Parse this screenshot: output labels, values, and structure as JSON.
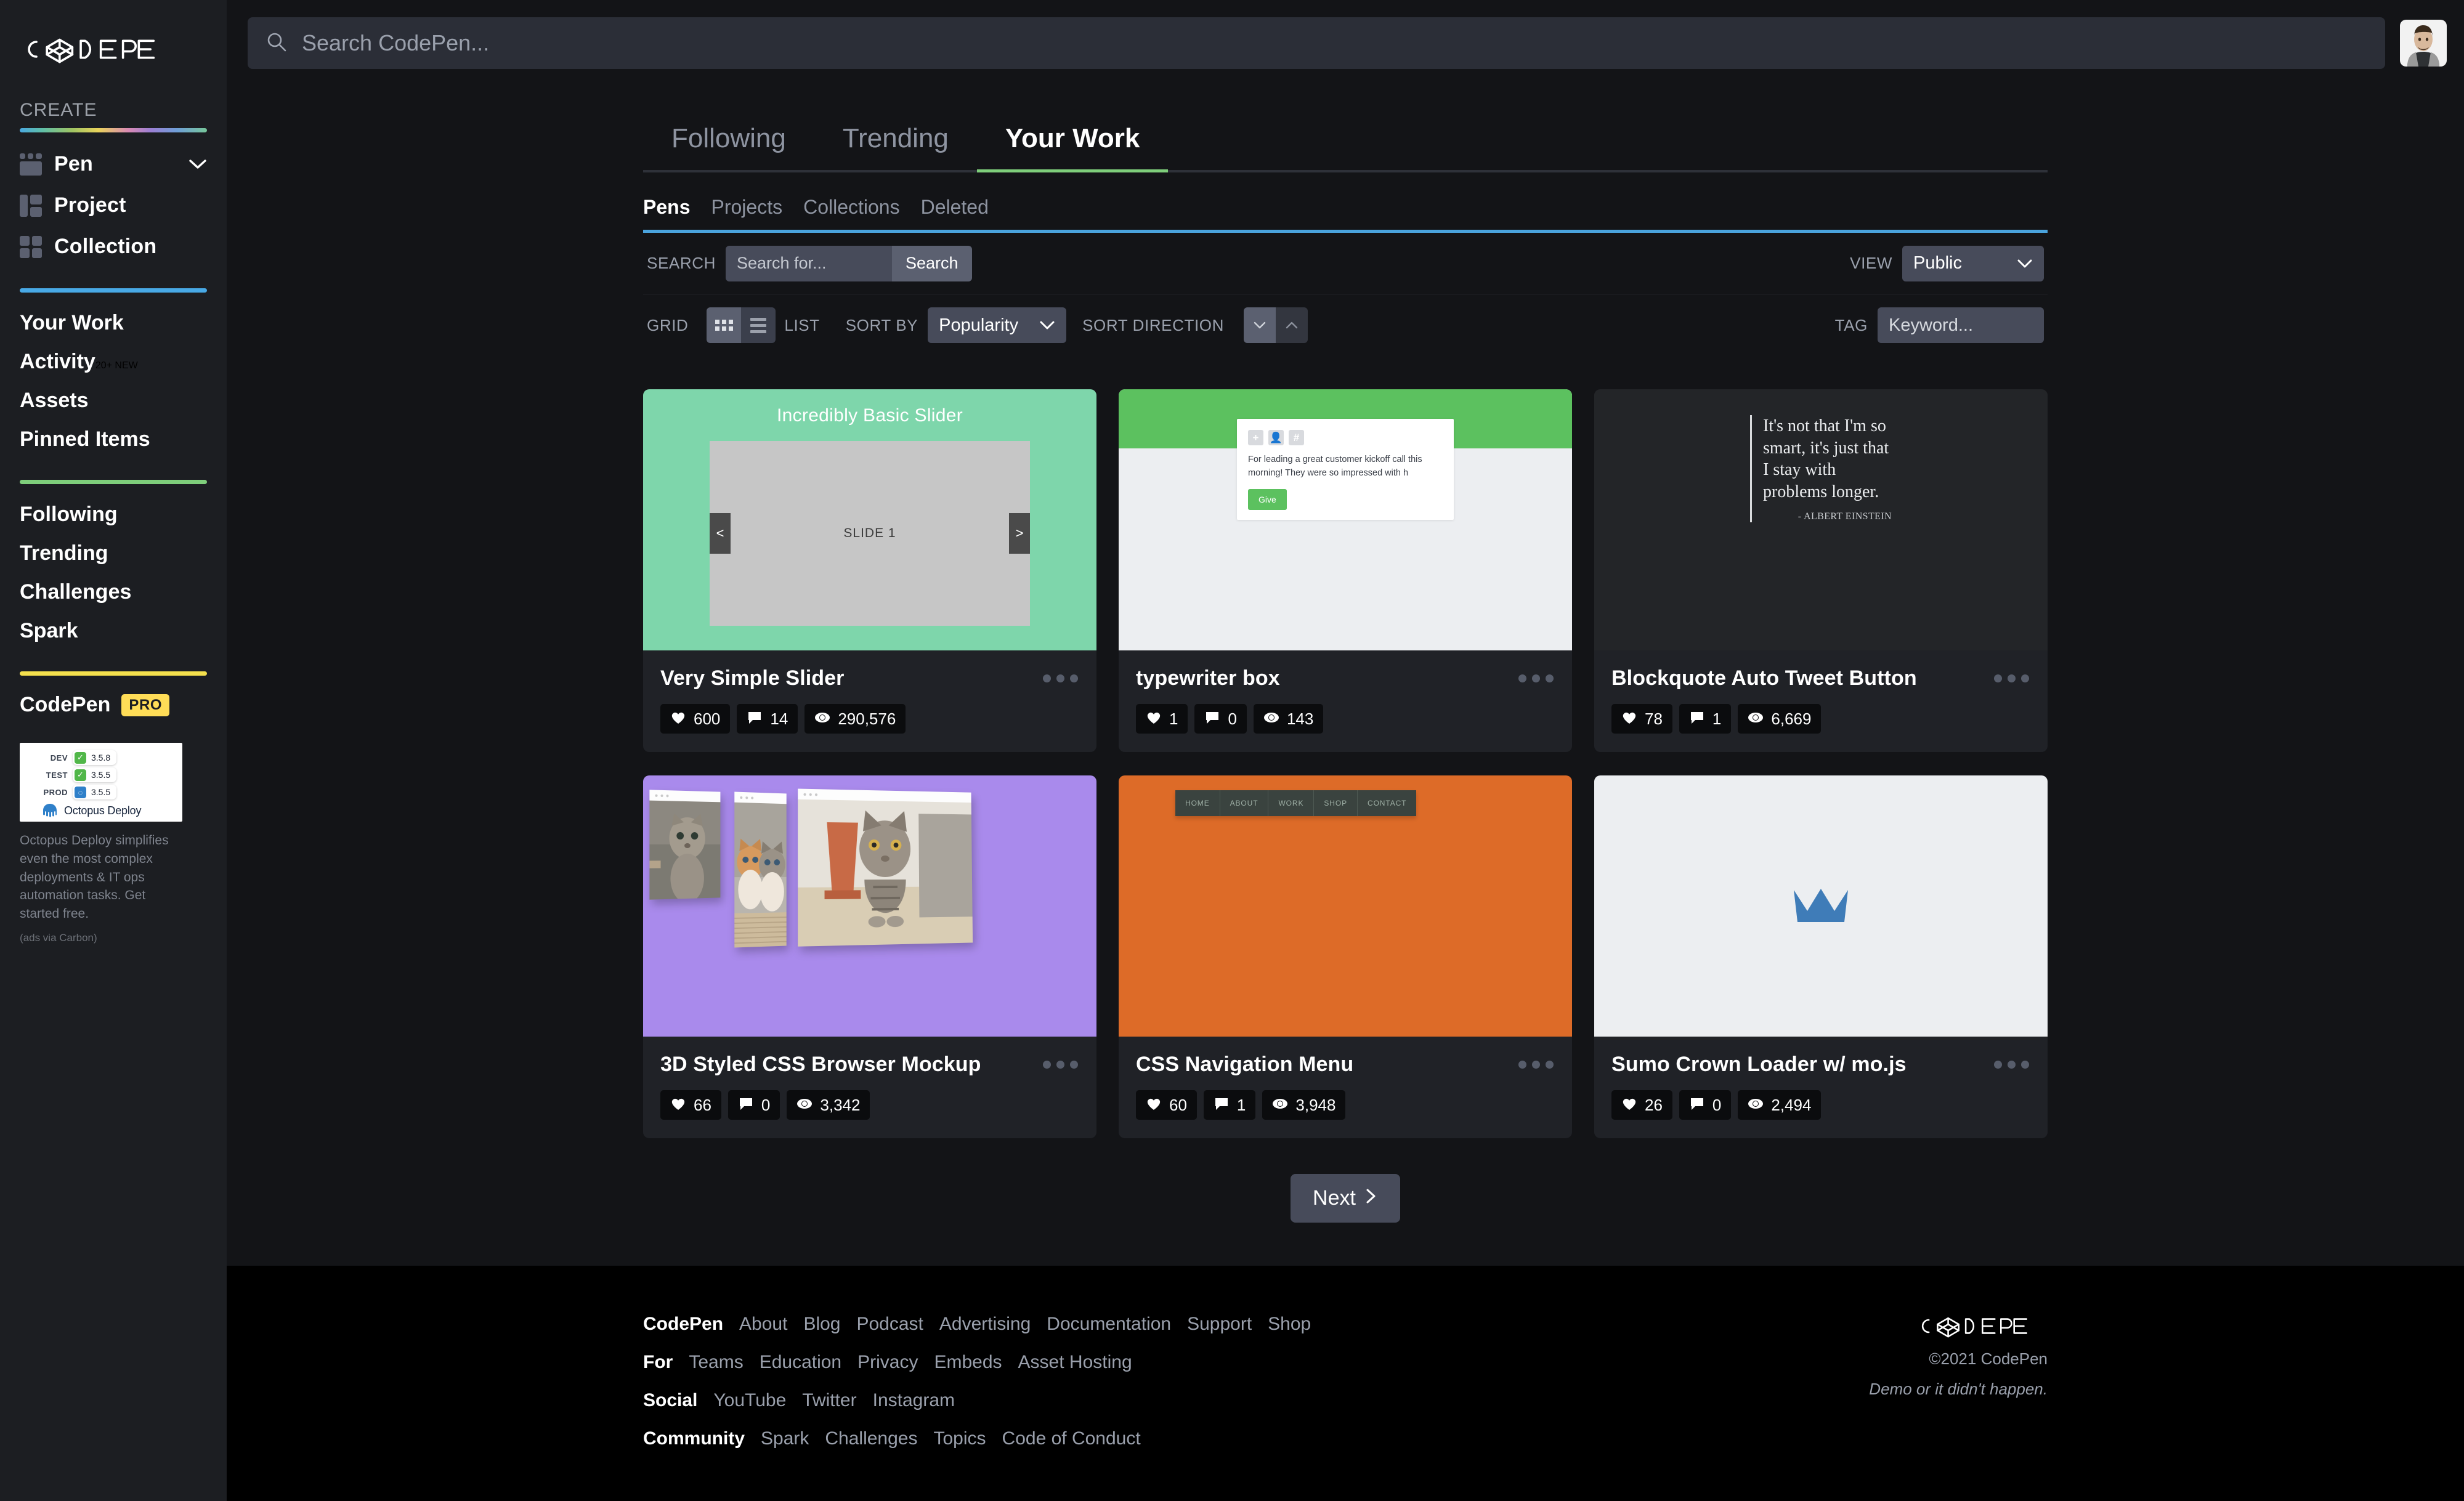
{
  "sidebar": {
    "logo_text": "CODEPEN",
    "create_label": "CREATE",
    "create_items": [
      {
        "label": "Pen",
        "icon": "pen-icon"
      },
      {
        "label": "Project",
        "icon": "project-icon"
      },
      {
        "label": "Collection",
        "icon": "collection-icon"
      }
    ],
    "work_items": [
      {
        "label": "Your Work",
        "badge": ""
      },
      {
        "label": "Activity",
        "badge": "20+ NEW"
      },
      {
        "label": "Assets",
        "badge": ""
      },
      {
        "label": "Pinned Items",
        "badge": ""
      }
    ],
    "browse_items": [
      {
        "label": "Following"
      },
      {
        "label": "Trending"
      },
      {
        "label": "Challenges"
      },
      {
        "label": "Spark"
      }
    ],
    "pro": {
      "name": "CodePen",
      "badge": "PRO"
    },
    "ad": {
      "rows": [
        {
          "env": "DEV",
          "status": "check",
          "version": "3.5.8"
        },
        {
          "env": "TEST",
          "status": "check",
          "version": "3.5.5"
        },
        {
          "env": "PROD",
          "status": "spinner",
          "version": "3.5.5"
        }
      ],
      "brand": "Octopus Deploy",
      "text": "Octopus Deploy simplifies even the most complex deployments & IT ops automation tasks. Get started free.",
      "via": "(ads via Carbon)"
    },
    "colors": {
      "create_rule": "gradient",
      "work_rule": "#48a9e6",
      "browse_rule": "#7ece7b",
      "pro_rule": "#f4e04d",
      "pro_badge": "#ffdd57"
    }
  },
  "topbar": {
    "search_placeholder": "Search CodePen...",
    "search_value": "",
    "search_icon": "search-icon",
    "avatar": "user-avatar"
  },
  "main_tabs": [
    {
      "label": "Following",
      "active": false
    },
    {
      "label": "Trending",
      "active": false
    },
    {
      "label": "Your Work",
      "active": true
    }
  ],
  "sub_tabs": [
    {
      "label": "Pens",
      "active": true
    },
    {
      "label": "Projects",
      "active": false
    },
    {
      "label": "Collections",
      "active": false
    },
    {
      "label": "Deleted",
      "active": false
    }
  ],
  "filters": {
    "search_label": "SEARCH",
    "search_placeholder": "Search for...",
    "search_value": "",
    "search_button": "Search",
    "view_label": "VIEW",
    "view_value": "Public",
    "grid_label": "GRID",
    "list_label": "LIST",
    "sort_by_label": "SORT BY",
    "sort_by_value": "Popularity",
    "sort_direction_label": "SORT DIRECTION",
    "tag_label": "TAG",
    "tag_placeholder": "Keyword...",
    "tag_value": ""
  },
  "pens": [
    {
      "title": "Very Simple Slider",
      "likes": "600",
      "comments": "14",
      "views": "290,576",
      "thumb": {
        "kind": "slider",
        "heading": "Incredibly Basic Slider",
        "slide_label": "SLIDE 1",
        "prev": "<",
        "next": ">",
        "bg": "#7ed6ab"
      }
    },
    {
      "title": "typewriter box",
      "likes": "1",
      "comments": "0",
      "views": "143",
      "thumb": {
        "kind": "typewriter",
        "message": "For leading a great customer kickoff call this morning! They were so impressed with h",
        "button": "Give",
        "icons": [
          "+",
          "☰",
          "#"
        ],
        "bg": "#5cc15f"
      }
    },
    {
      "title": "Blockquote Auto Tweet Button",
      "likes": "78",
      "comments": "1",
      "views": "6,669",
      "thumb": {
        "kind": "quote",
        "quote": "It's not that I'm so smart, it's just that I stay with problems longer.",
        "attribution": "- ALBERT EINSTEIN",
        "bg": "#232528"
      }
    },
    {
      "title": "3D Styled CSS Browser Mockup",
      "likes": "66",
      "comments": "0",
      "views": "3,342",
      "thumb": {
        "kind": "mockup",
        "bg": "#a98aec"
      }
    },
    {
      "title": "CSS Navigation Menu",
      "likes": "60",
      "comments": "1",
      "views": "3,948",
      "thumb": {
        "kind": "navmenu",
        "items": [
          "HOME",
          "ABOUT",
          "WORK",
          "SHOP",
          "CONTACT"
        ],
        "bg": "#dd6b28"
      }
    },
    {
      "title": "Sumo Crown Loader w/ mo.js",
      "likes": "26",
      "comments": "0",
      "views": "2,494",
      "thumb": {
        "kind": "crown",
        "bg": "#eceef1",
        "crown_color": "#3f7cb8"
      }
    }
  ],
  "pager": {
    "next_label": "Next"
  },
  "footer": {
    "rows": [
      {
        "head": "CodePen",
        "links": [
          "About",
          "Blog",
          "Podcast",
          "Advertising",
          "Documentation",
          "Support",
          "Shop"
        ]
      },
      {
        "head": "For",
        "links": [
          "Teams",
          "Education",
          "Privacy",
          "Embeds",
          "Asset Hosting"
        ]
      },
      {
        "head": "Social",
        "links": [
          "YouTube",
          "Twitter",
          "Instagram"
        ]
      },
      {
        "head": "Community",
        "links": [
          "Spark",
          "Challenges",
          "Topics",
          "Code of Conduct"
        ]
      }
    ],
    "logo_text": "CODEPEN",
    "copyright": "©2021 CodePen",
    "tagline": "Demo or it didn't happen."
  }
}
